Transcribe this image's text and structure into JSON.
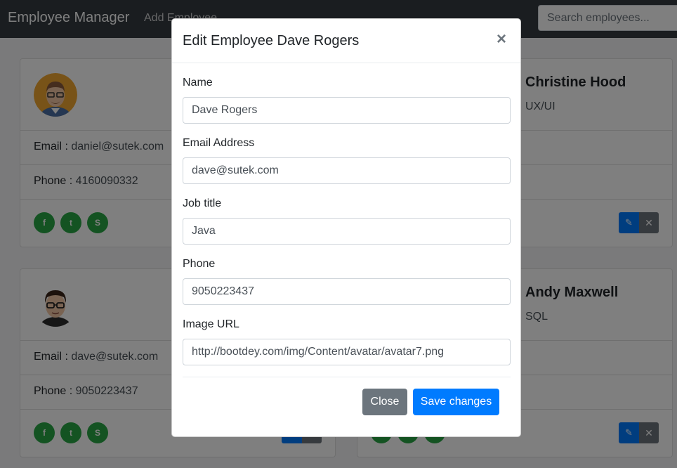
{
  "navbar": {
    "brand": "Employee Manager",
    "add_link": "Add Employee",
    "search_placeholder": "Search employees..."
  },
  "cards": [
    {
      "email_label": "Email : ",
      "email": "daniel@sutek.com",
      "phone_label": "Phone : ",
      "phone": "4160090332"
    },
    {
      "name": "Christine Hood",
      "job": "UX/UI"
    },
    {
      "email_label": "Email : ",
      "email": "dave@sutek.com",
      "phone_label": "Phone : ",
      "phone": "9050223437"
    },
    {
      "name": "Andy Maxwell",
      "job": "SQL"
    }
  ],
  "modal": {
    "title": "Edit Employee Dave Rogers",
    "close_symbol": "×",
    "fields": {
      "name": {
        "label": "Name",
        "value": "Dave Rogers"
      },
      "email": {
        "label": "Email Address",
        "value": "dave@sutek.com"
      },
      "job": {
        "label": "Job title",
        "value": "Java"
      },
      "phone": {
        "label": "Phone",
        "value": "9050223437"
      },
      "image": {
        "label": "Image URL",
        "value": "http://bootdey.com/img/Content/avatar/avatar7.png"
      }
    },
    "close_button": "Close",
    "save_button": "Save changes"
  },
  "icons": {
    "social": [
      "facebook-icon",
      "twitter-icon",
      "skype-icon"
    ],
    "edit": "pencil-icon",
    "delete": "times-icon"
  },
  "colors": {
    "navbar": "#343a40",
    "primary": "#007bff",
    "secondary": "#6c757d",
    "social": "#28a745"
  }
}
